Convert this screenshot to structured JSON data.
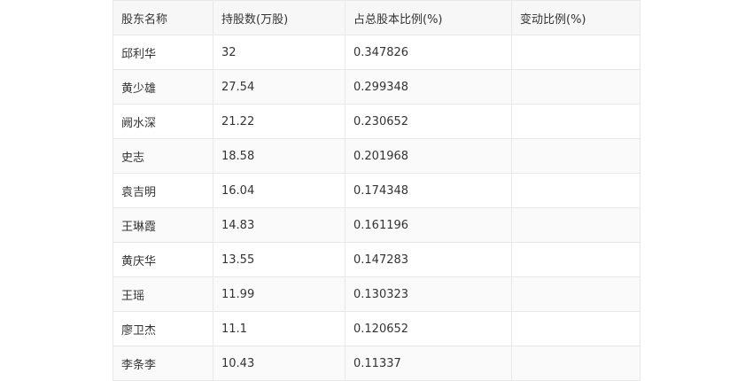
{
  "table": {
    "headers": [
      "股东名称",
      "持股数(万股)",
      "占总股本比例(%)",
      "变动比例(%)"
    ],
    "rows": [
      [
        "邱利华",
        "32",
        "0.347826",
        ""
      ],
      [
        "黄少雄",
        "27.54",
        "0.299348",
        ""
      ],
      [
        "阙水深",
        "21.22",
        "0.230652",
        ""
      ],
      [
        "史志",
        "18.58",
        "0.201968",
        ""
      ],
      [
        "袁吉明",
        "16.04",
        "0.174348",
        ""
      ],
      [
        "王琳霞",
        "14.83",
        "0.161196",
        ""
      ],
      [
        "黄庆华",
        "13.55",
        "0.147283",
        ""
      ],
      [
        "王瑶",
        "11.99",
        "0.130323",
        ""
      ],
      [
        "廖卫杰",
        "11.1",
        "0.120652",
        ""
      ],
      [
        "李条李",
        "10.43",
        "0.11337",
        ""
      ]
    ]
  }
}
